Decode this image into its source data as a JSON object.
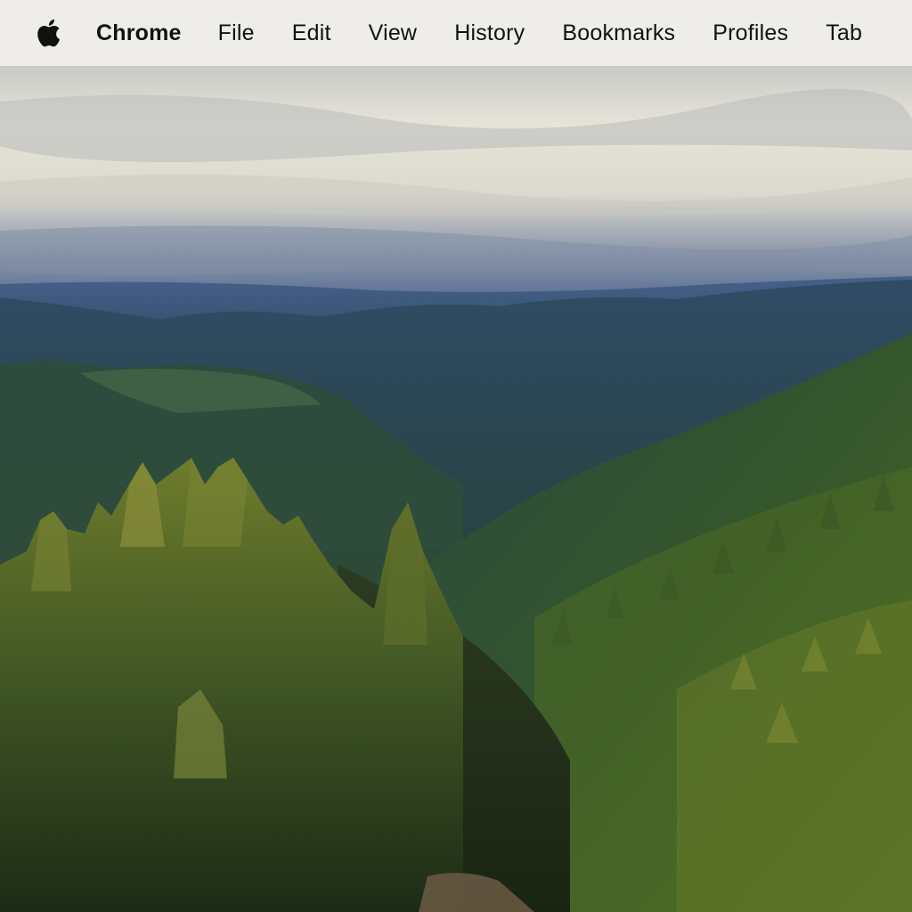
{
  "menubar": {
    "apple_icon": "apple-logo-icon",
    "app_name": "Chrome",
    "items": [
      "File",
      "Edit",
      "View",
      "History",
      "Bookmarks",
      "Profiles",
      "Tab"
    ]
  },
  "wallpaper": {
    "subject": "forested-mountain-valley",
    "colors": {
      "sky": "#dcdad0",
      "far_ridge": "#3f5a80",
      "mid_hills": "#2e4d5e",
      "foreground_trees": "#4f6a2a"
    }
  }
}
